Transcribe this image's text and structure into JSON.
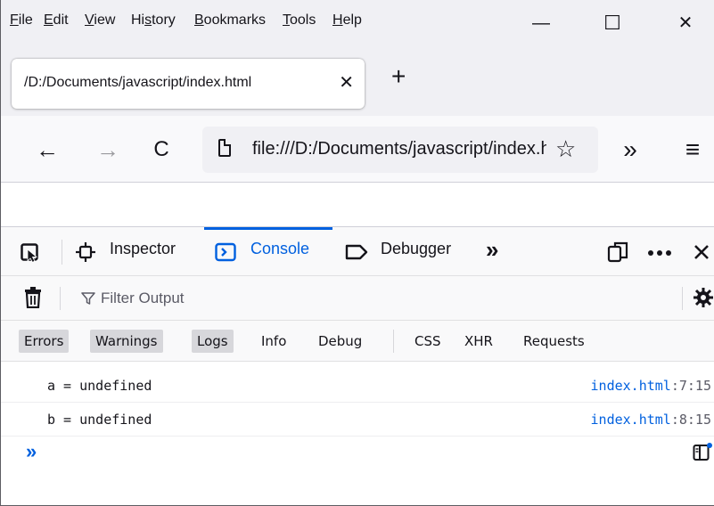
{
  "menubar": {
    "items": [
      {
        "label": "File",
        "key": "F",
        "rest": "ile"
      },
      {
        "label": "Edit",
        "key": "E",
        "rest": "dit"
      },
      {
        "label": "View",
        "key": "V",
        "rest": "iew"
      },
      {
        "label": "History",
        "pre": "Hi",
        "key": "s",
        "rest": "tory"
      },
      {
        "label": "Bookmarks",
        "key": "B",
        "rest": "ookmarks"
      },
      {
        "label": "Tools",
        "key": "T",
        "rest": "ools"
      },
      {
        "label": "Help",
        "key": "H",
        "rest": "elp"
      }
    ],
    "minimize": "—",
    "maximize": "☐",
    "close": "✕"
  },
  "tabs": {
    "active_title": "/D:/Documents/javascript/index.html",
    "close": "✕",
    "new_tab": "+"
  },
  "nav": {
    "back": "←",
    "forward": "→",
    "reload": "C",
    "url": "file:///D:/Documents/javascript/index.html",
    "bookmark_star": "☆",
    "overflow": "»",
    "menu": "≡"
  },
  "devtools": {
    "tabs": {
      "inspector": "Inspector",
      "console": "Console",
      "debugger": "Debugger",
      "more": "»"
    },
    "toolbar": {
      "filter_placeholder": "Filter Output"
    },
    "filters": [
      "Errors",
      "Warnings",
      "Logs",
      "Info",
      "Debug",
      "CSS",
      "XHR",
      "Requests"
    ],
    "filters_active": [
      "Errors",
      "Warnings",
      "Logs"
    ],
    "messages": [
      {
        "text": "a = undefined",
        "file": "index.html",
        "pos": ":7:15"
      },
      {
        "text": "b = undefined",
        "file": "index.html",
        "pos": ":8:15"
      }
    ],
    "prompt": "»"
  },
  "colors": {
    "accent": "#0060df",
    "toolbar_bg": "#f9f9fa",
    "chrome_bg": "#f0f0f4",
    "filter_on": "#d7d7db"
  }
}
